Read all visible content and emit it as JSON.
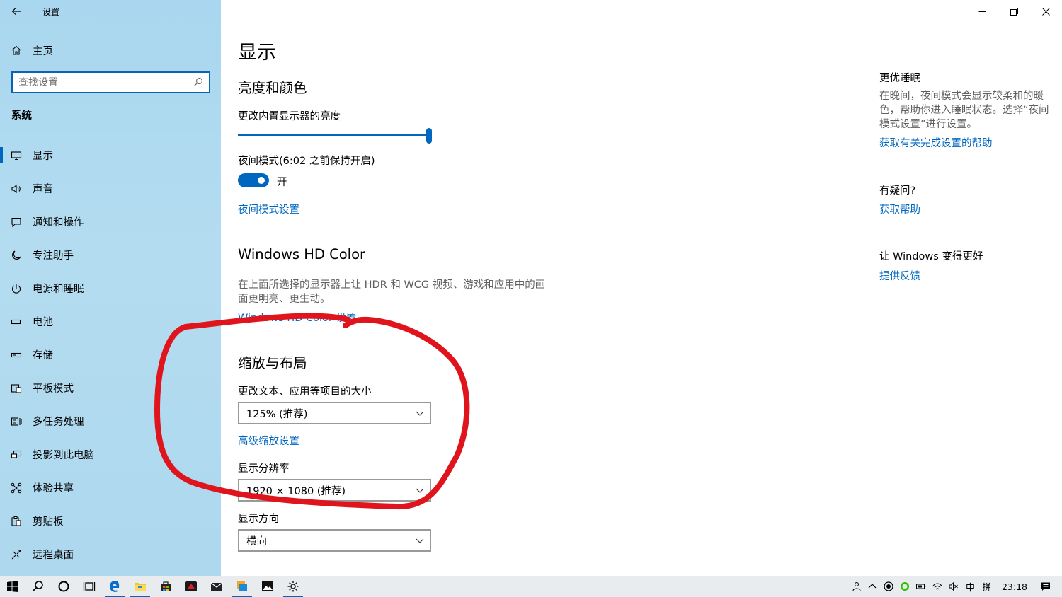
{
  "window": {
    "title": "设置"
  },
  "sidebar": {
    "home_label": "主页",
    "search_placeholder": "查找设置",
    "section_title": "系统",
    "items": [
      {
        "label": "显示",
        "icon": "monitor-icon",
        "active": true
      },
      {
        "label": "声音",
        "icon": "speaker-icon"
      },
      {
        "label": "通知和操作",
        "icon": "notification-icon"
      },
      {
        "label": "专注助手",
        "icon": "moon-icon"
      },
      {
        "label": "电源和睡眠",
        "icon": "power-icon"
      },
      {
        "label": "电池",
        "icon": "battery-icon"
      },
      {
        "label": "存储",
        "icon": "storage-icon"
      },
      {
        "label": "平板模式",
        "icon": "tablet-icon"
      },
      {
        "label": "多任务处理",
        "icon": "multitask-icon"
      },
      {
        "label": "投影到此电脑",
        "icon": "project-icon"
      },
      {
        "label": "体验共享",
        "icon": "share-icon"
      },
      {
        "label": "剪贴板",
        "icon": "clipboard-icon"
      },
      {
        "label": "远程桌面",
        "icon": "remote-icon"
      }
    ]
  },
  "main": {
    "page_title": "显示",
    "brightness": {
      "heading": "亮度和颜色",
      "label": "更改内置显示器的亮度",
      "value": 1.0,
      "night_mode_label": "夜间模式(6:02 之前保持开启)",
      "toggle_state": "开",
      "night_mode_link": "夜间模式设置"
    },
    "hdr": {
      "heading": "Windows HD Color",
      "description": "在上面所选择的显示器上让 HDR 和 WCG 视频、游戏和应用中的画面更明亮、更生动。",
      "link": "Windows HD Color 设置"
    },
    "scale": {
      "heading": "缩放与布局",
      "size_label": "更改文本、应用等项目的大小",
      "size_value": "125% (推荐)",
      "advanced_link": "高级缩放设置",
      "resolution_label": "显示分辨率",
      "resolution_value": "1920 × 1080 (推荐)",
      "orientation_label": "显示方向",
      "orientation_value": "横向"
    }
  },
  "aside": {
    "sleep_heading": "更优睡眠",
    "sleep_text": "在晚间，夜间模式会显示较柔和的暖色，帮助你进入睡眠状态。选择“夜间模式设置”进行设置。",
    "sleep_link": "获取有关完成设置的帮助",
    "question_heading": "有疑问?",
    "question_link": "获取帮助",
    "improve_heading": "让 Windows 变得更好",
    "improve_link": "提供反馈"
  },
  "taskbar": {
    "clock": "23:18",
    "ime_mode": "中",
    "ime_layout": "拼",
    "apps": [
      "start-icon",
      "search-icon",
      "cortana-icon",
      "task-view-icon",
      "edge-icon",
      "file-explorer-icon",
      "store-icon",
      "game-icon",
      "mail-icon",
      "app-icon",
      "photos-icon",
      "settings-icon"
    ]
  },
  "colors": {
    "accent": "#0067c0",
    "annotation": "#e0141c",
    "sidebar_bg": "#add8ee"
  }
}
